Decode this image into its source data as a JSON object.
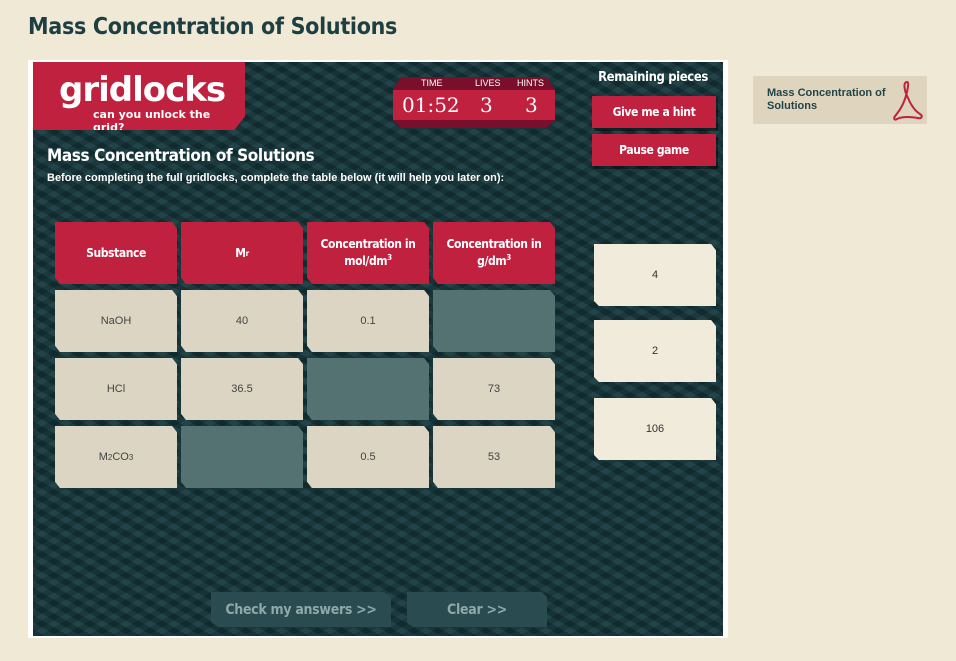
{
  "page": {
    "title": "Mass Concentration of Solutions"
  },
  "logo": {
    "title": "gridlocks",
    "tagline": "can you unlock the grid?"
  },
  "game": {
    "heading": "Mass Concentration of Solutions",
    "instructions": "Before completing the full gridlocks, complete the table below (it will help you later on):"
  },
  "stats": {
    "time_label": "TIME",
    "lives_label": "LIVES",
    "hints_label": "HINTS",
    "time": "01:52",
    "lives": "3",
    "hints": "3"
  },
  "panel": {
    "title": "Remaining pieces",
    "hint_button": "Give me a hint",
    "pause_button": "Pause game",
    "pieces": [
      "4",
      "2",
      "106"
    ]
  },
  "table": {
    "headers": {
      "substance": "Substance",
      "mr_base": "M",
      "mr_sub": "r",
      "conc_mol_line1": "Concentration in",
      "conc_mol_line2": "mol/dm",
      "conc_mol_sup": "3",
      "conc_g_line1": "Concentration in",
      "conc_g_line2": "g/dm",
      "conc_g_sup": "3"
    },
    "rows": [
      {
        "substance": "NaOH",
        "mr": "40",
        "mol": "0.1",
        "g": ""
      },
      {
        "substance": "HCl",
        "mr": "36.5",
        "mol": "",
        "g": "73"
      },
      {
        "substance_base": "M",
        "substance_sub1": "2",
        "substance_mid": "CO",
        "substance_sub2": "3",
        "mr": "",
        "mol": "0.5",
        "g": "53"
      }
    ]
  },
  "buttons": {
    "check": "Check my answers >>",
    "clear": "Clear >>"
  },
  "pdf": {
    "label": "Mass Concentration of Solutions",
    "icon": "adobe-pdf-icon",
    "icon_color": "#c0213f"
  },
  "colors": {
    "red": "#c0213f",
    "dark_red": "#7a0f2c",
    "board": "#173a3f",
    "cream": "#f1ebdb",
    "empty": "#547272"
  }
}
